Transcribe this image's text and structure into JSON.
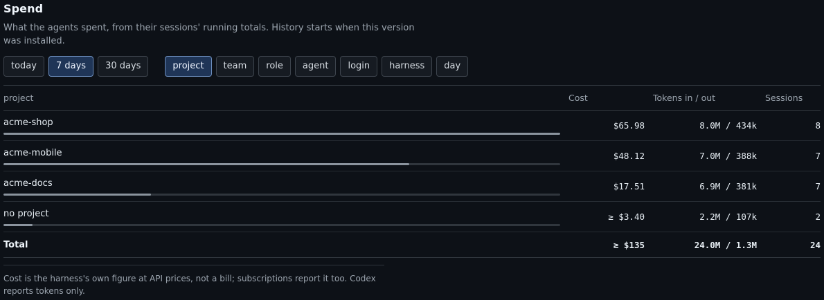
{
  "header": {
    "title": "Spend",
    "description": "What the agents spent, from their sessions' running totals. History starts when this version was installed."
  },
  "range_options": [
    {
      "label": "today",
      "active": false
    },
    {
      "label": "7 days",
      "active": true
    },
    {
      "label": "30 days",
      "active": false
    }
  ],
  "group_options": [
    {
      "label": "project",
      "active": true
    },
    {
      "label": "team",
      "active": false
    },
    {
      "label": "role",
      "active": false
    },
    {
      "label": "agent",
      "active": false
    },
    {
      "label": "login",
      "active": false
    },
    {
      "label": "harness",
      "active": false
    },
    {
      "label": "day",
      "active": false
    }
  ],
  "table": {
    "columns": {
      "group": "project",
      "cost": "Cost",
      "tokens": "Tokens in / out",
      "sessions": "Sessions"
    },
    "rows": [
      {
        "name": "acme-shop",
        "cost": "$65.98",
        "tokens": "8.0M / 434k",
        "sessions": "8",
        "share": 1.0
      },
      {
        "name": "acme-mobile",
        "cost": "$48.12",
        "tokens": "7.0M / 388k",
        "sessions": "7",
        "share": 0.729
      },
      {
        "name": "acme-docs",
        "cost": "$17.51",
        "tokens": "6.9M / 381k",
        "sessions": "7",
        "share": 0.265
      },
      {
        "name": "no project",
        "cost": "≥ $3.40",
        "tokens": "2.2M / 107k",
        "sessions": "2",
        "share": 0.052
      }
    ],
    "total": {
      "label": "Total",
      "cost": "≥ $135",
      "tokens": "24.0M / 1.3M",
      "sessions": "24"
    }
  },
  "footnote": "Cost is the harness's own figure at API prices, not a bill; subscriptions report it too. Codex reports tokens only.",
  "colors": {
    "background": "#0d1117",
    "active_button": "#1f3557",
    "bar_fill": "#8b949e",
    "bar_track": "#30363d"
  }
}
